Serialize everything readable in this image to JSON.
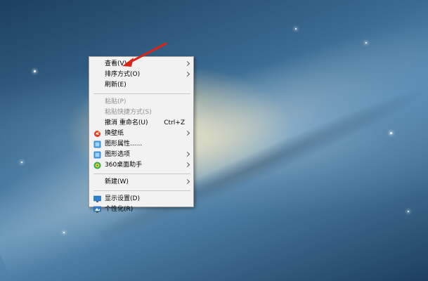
{
  "desktop": {
    "background": "galaxy-wallpaper"
  },
  "context_menu": {
    "items": [
      {
        "label": "查看(V)",
        "has_submenu": true,
        "disabled": false
      },
      {
        "label": "排序方式(O)",
        "has_submenu": true,
        "disabled": false
      },
      {
        "label": "刷新(E)",
        "has_submenu": false,
        "disabled": false
      },
      {
        "label": "粘贴(P)",
        "has_submenu": false,
        "disabled": true
      },
      {
        "label": "粘贴快捷方式(S)",
        "has_submenu": false,
        "disabled": true
      },
      {
        "label": "撤消 重命名(U)",
        "shortcut": "Ctrl+Z",
        "has_submenu": false,
        "disabled": false
      },
      {
        "label": "换壁纸",
        "icon": "wallpaper-icon",
        "has_submenu": true,
        "disabled": false
      },
      {
        "label": "图形属性......",
        "icon": "graphics-properties-icon",
        "has_submenu": false,
        "disabled": false
      },
      {
        "label": "图形选项",
        "icon": "graphics-options-icon",
        "has_submenu": true,
        "disabled": false
      },
      {
        "label": "360桌面助手",
        "icon": "360-icon",
        "has_submenu": true,
        "disabled": false
      },
      {
        "label": "新建(W)",
        "has_submenu": true,
        "disabled": false
      },
      {
        "label": "显示设置(D)",
        "icon": "display-icon",
        "has_submenu": false,
        "disabled": false
      },
      {
        "label": "个性化(R)",
        "icon": "personalize-icon",
        "has_submenu": false,
        "disabled": false
      }
    ]
  },
  "annotation": {
    "arrow_color": "#d9261c"
  }
}
